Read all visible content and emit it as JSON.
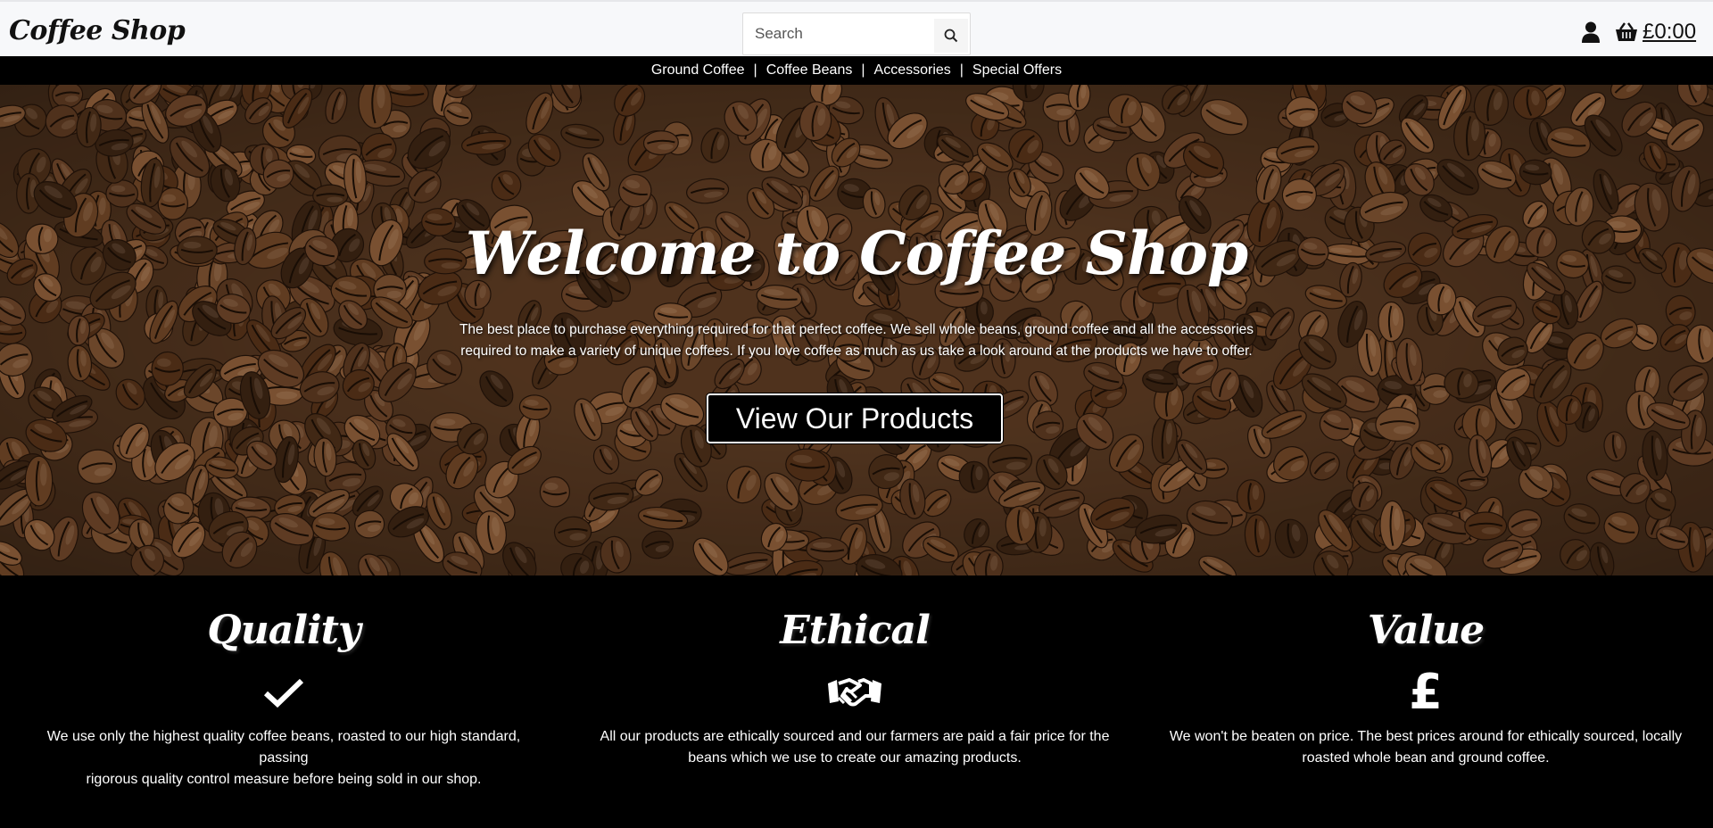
{
  "header": {
    "brand": "Coffee Shop",
    "search_placeholder": "Search",
    "basket_total": "£0:00"
  },
  "nav": {
    "items": [
      "Ground Coffee",
      "Coffee Beans",
      "Accessories",
      "Special Offers"
    ],
    "separator": "|"
  },
  "hero": {
    "title": "Welcome to Coffee Shop",
    "text_line1": "The best place to purchase everything required for that perfect coffee. We sell whole beans, ground coffee and all the accessories",
    "text_line2": "required to make a variety of unique coffees. If you love coffee as much as us take a look around at the products we have to offer.",
    "button_label": "View Our Products"
  },
  "features": [
    {
      "title": "Quality",
      "icon": "check-icon",
      "line1": "We use only the highest quality coffee beans, roasted to our high standard, passing",
      "line2": "rigorous quality control measure before being sold in our shop."
    },
    {
      "title": "Ethical",
      "icon": "handshake-icon",
      "line1": "All our products are ethically sourced and our farmers are paid a fair price for the",
      "line2": "beans which we use to create our amazing products."
    },
    {
      "title": "Value",
      "icon": "pound-icon",
      "icon_glyph": "£",
      "line1": "We won't be beaten on price. The best prices around for ethically sourced, locally",
      "line2": "roasted whole bean and ground coffee."
    }
  ],
  "colors": {
    "header_bg": "#f7f8fa",
    "dark": "#000000",
    "hero_bean": "#5a3a22"
  }
}
